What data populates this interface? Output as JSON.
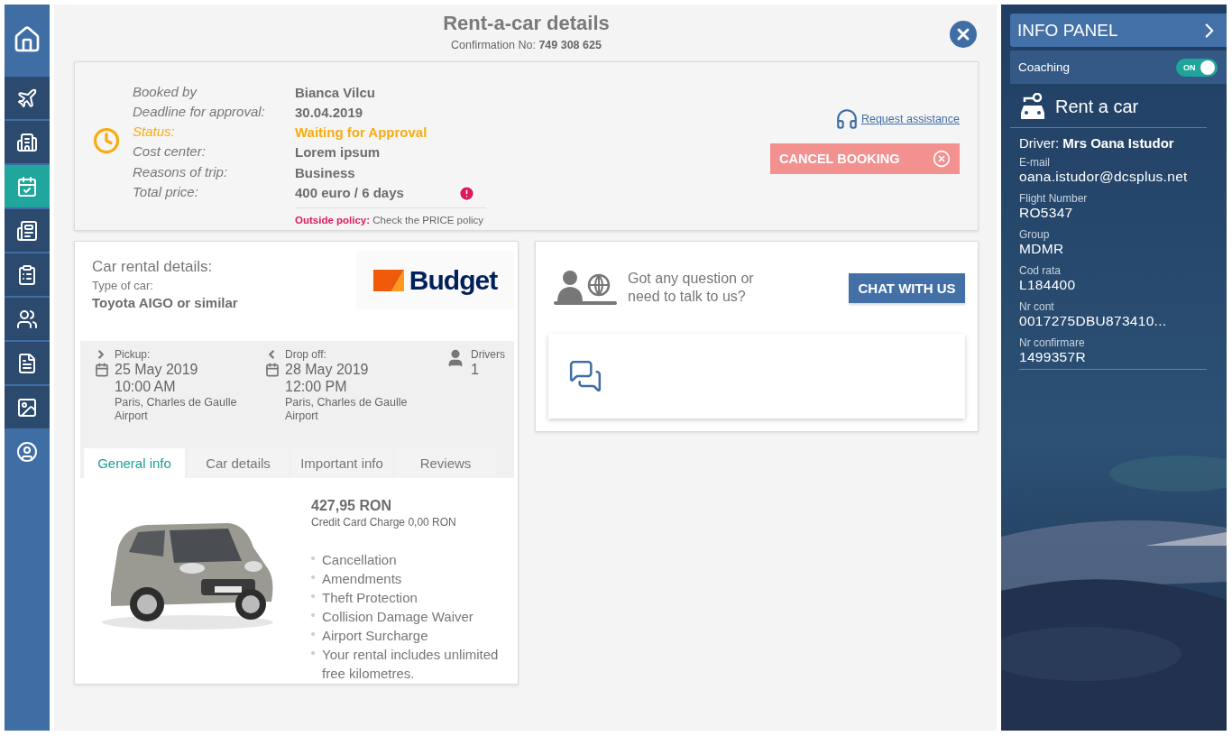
{
  "sidebar": {
    "items": [
      {
        "kind": "home",
        "selected": false
      },
      {
        "kind": "flight",
        "selected": false
      },
      {
        "kind": "hotel",
        "selected": false
      },
      {
        "kind": "trips",
        "selected": true
      },
      {
        "kind": "news",
        "selected": false
      },
      {
        "kind": "approvals",
        "selected": false
      },
      {
        "kind": "travellers",
        "selected": false
      },
      {
        "kind": "reports",
        "selected": false
      },
      {
        "kind": "gallery",
        "selected": false
      },
      {
        "kind": "profile",
        "selected": false
      }
    ]
  },
  "header": {
    "title": "Rent-a-car details",
    "confirmation_label": "Confirmation No:",
    "confirmation_number": "749 308 625"
  },
  "booking": {
    "fields": [
      {
        "label": "Booked by",
        "value": "Bianca Vilcu",
        "kind": "plain"
      },
      {
        "label": "Deadline for approval:",
        "value": "30.04.2019",
        "kind": "plain"
      },
      {
        "label": "Status:",
        "value": "Waiting for Approval",
        "kind": "status"
      },
      {
        "label": "Cost center:",
        "value": "Lorem ipsum",
        "kind": "plain"
      },
      {
        "label": "Reasons of trip:",
        "value": "Business",
        "kind": "plain"
      },
      {
        "label": "Total price:",
        "value": "400 euro / 6 days",
        "kind": "alert"
      }
    ],
    "policy_label": "Outside policy:",
    "policy_text": "Check the PRICE policy",
    "assistance_link": "Request assistance",
    "cancel_button": "CANCEL BOOKING"
  },
  "car": {
    "title": "Car rental details:",
    "type_label": "Type of car:",
    "type_value": "Toyota AIGO or similar",
    "logo": "Budget",
    "trip": [
      {
        "kind": "pickup",
        "label": "Pickup:",
        "date": "25 May 2019",
        "time": "10:00 AM",
        "place": "Paris, Charles de Gaulle Airport"
      },
      {
        "kind": "dropoff",
        "label": "Drop off:",
        "date": "28 May 2019",
        "time": "12:00 PM",
        "place": "Paris, Charles de Gaulle Airport"
      }
    ],
    "drivers": {
      "label": "Drivers",
      "value": "1"
    },
    "tabs": [
      {
        "label": "General info",
        "selected": true
      },
      {
        "label": "Car details",
        "selected": false
      },
      {
        "label": "Important info",
        "selected": false
      },
      {
        "label": "Reviews",
        "selected": false
      }
    ],
    "price": "427,95 RON",
    "card_charge": "Credit Card Charge  0,00 RON",
    "inclusions": [
      "Cancellation",
      "Amendments",
      "Theft Protection",
      "Collision Damage Waiver",
      "Airport Surcharge",
      "Your rental includes unlimited free kilometres."
    ]
  },
  "chat": {
    "prompt": "Got any question or need to talk to us?",
    "button": "CHAT WITH US"
  },
  "info_panel": {
    "title": "INFO PANEL",
    "coaching": {
      "label": "Coaching",
      "on": true,
      "toggle_text": "ON"
    },
    "section": "Rent a car",
    "driver_label": "Driver:",
    "driver_name": "Mrs Oana Istudor",
    "fields": [
      {
        "label": "E-mail",
        "value": "oana.istudor@dcsplus.net"
      },
      {
        "label": "Flight Number",
        "value": "RO5347"
      },
      {
        "label": "Group",
        "value": "MDMR"
      },
      {
        "label": "Cod rata",
        "value": "L184400"
      },
      {
        "label": "Nr cont",
        "value": "0017275DBU873410..."
      },
      {
        "label": "Nr confirmare",
        "value": "1499357R"
      }
    ]
  }
}
